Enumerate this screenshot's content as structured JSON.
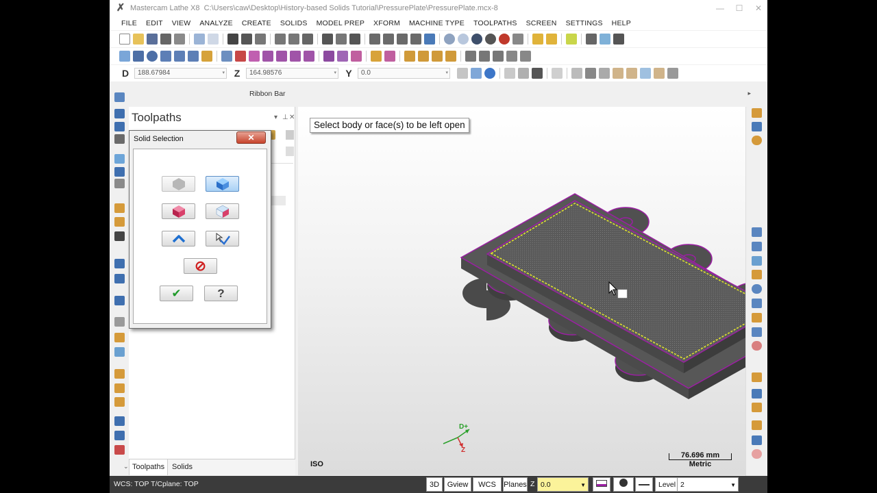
{
  "window": {
    "app_title": "Mastercam Lathe X8",
    "file_path": "C:\\Users\\caw\\Desktop\\History-based Solids Tutorial\\PressurePlate\\PressurePlate.mcx-8",
    "logo_glyph": "✗",
    "minimize_glyph": "—",
    "maximize_glyph": "☐",
    "close_glyph": "✕"
  },
  "menu": [
    "FILE",
    "EDIT",
    "VIEW",
    "ANALYZE",
    "CREATE",
    "SOLIDS",
    "MODEL PREP",
    "XFORM",
    "MACHINE TYPE",
    "TOOLPATHS",
    "SCREEN",
    "SETTINGS",
    "HELP"
  ],
  "coords": {
    "d_label": "D",
    "d_value": "188.67984",
    "z_label": "Z",
    "z_value": "164.98576",
    "y_label": "Y",
    "y_value": "0.0"
  },
  "ribbon": {
    "label": "Ribbon Bar",
    "expand_glyph": "▸"
  },
  "toolpaths_panel": {
    "title": "Toolpaths",
    "pin_glyph": "⊥",
    "close_glyph": "✕",
    "dropdown_glyph": "▾",
    "tabs": [
      "Toolpaths",
      "Solids"
    ]
  },
  "dialog": {
    "title": "Solid Selection",
    "close_glyph": "✕",
    "ok_glyph": "✔",
    "help_glyph": "?",
    "cancel_glyph": "⊘"
  },
  "viewport": {
    "prompt": "Select body or face(s) to be left open",
    "view_name": "ISO",
    "scale_value": "76.696 mm",
    "scale_unit": "Metric",
    "axis_d": "D+",
    "axis_z": "Z"
  },
  "status": {
    "wcs_text": "WCS: TOP  T/Cplane: TOP",
    "btn_3d": "3D",
    "btn_gview": "Gview",
    "btn_wcs": "WCS",
    "btn_planes": "Planes",
    "z_label": "Z",
    "z_value": "0.0",
    "level_label": "Level",
    "level_value": "2"
  },
  "colors": {
    "accent_purple": "#9b1fa3",
    "part_fill": "#555555",
    "status_bg": "#3b3b3b",
    "z_field_yellow": "#fbf39a"
  }
}
